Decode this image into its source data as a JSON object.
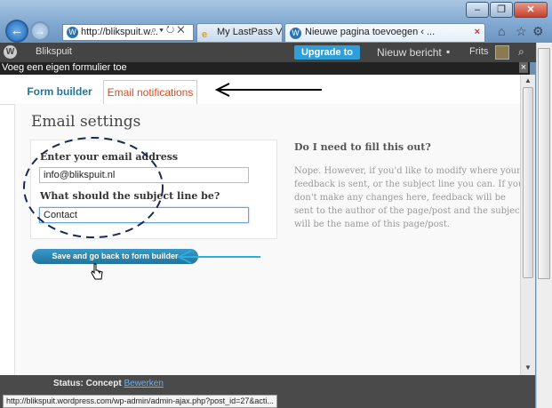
{
  "browser": {
    "address": "http://blikspuit.w...",
    "address_controls": "⌕ ▾ ↻ ✕",
    "tab_lastpass": "My LastPass Vault",
    "tab_active": "Nieuwe pagina toevoegen ‹ ...",
    "tab_close": "×",
    "status_url": "http://blikspuit.wordpress.com/wp-admin/admin-ajax.php?post_id=27&acti..."
  },
  "window_buttons": {
    "minimize": "–",
    "restore": "❐",
    "close": "✕",
    "back": "←",
    "forward": "→"
  },
  "toolbar_icons": {
    "home": "⌂",
    "star": "☆",
    "gear": "⚙"
  },
  "adminbar": {
    "site": "Blikspuit",
    "upgrade": "Upgrade to Pro",
    "new_post": "Nieuw bericht",
    "comments": "▪",
    "user": "Frits",
    "search": "⌕"
  },
  "dialog": {
    "title": "Voeg een eigen formulier toe",
    "close": "×"
  },
  "tabs": {
    "form_builder": "Form builder",
    "email_notifications": "Email notifications"
  },
  "email_settings": {
    "heading": "Email settings",
    "email_label": "Enter your email address",
    "email_value": "info@blikspuit.nl",
    "subject_label": "What should the subject line be?",
    "subject_value": "Contact",
    "save_button": "Save and go back to form builder"
  },
  "help": {
    "question": "Do I need to fill this out?",
    "answer": "Nope. However, if you'd like to modify where your feedback is sent, or the subject line you can. If you don't make any changes here, feedback will be sent to the author of the page/post and the subject will be the name of this page/post."
  },
  "footer": {
    "status_label": "Status: Concept",
    "edit_link": "Bewerken"
  },
  "colors": {
    "link": "#21759b",
    "active_tab": "#d54e21",
    "upgrade": "#2e9fd8"
  }
}
